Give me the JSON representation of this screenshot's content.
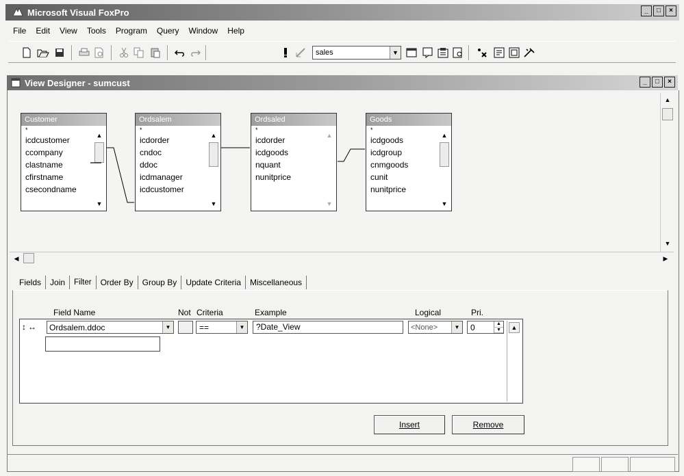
{
  "app": {
    "title": "Microsoft Visual FoxPro"
  },
  "menu": [
    "File",
    "Edit",
    "View",
    "Tools",
    "Program",
    "Query",
    "Window",
    "Help"
  ],
  "toolbar": {
    "database_combo_value": "sales"
  },
  "designer": {
    "title": "View Designer - sumcust",
    "tables": [
      {
        "name": "Customer",
        "fields": [
          "*",
          "icdcustomer",
          "ccompany",
          "clastname",
          "cfirstname",
          "csecondname"
        ]
      },
      {
        "name": "Ordsalem",
        "fields": [
          "*",
          "icdorder",
          "cndoc",
          "ddoc",
          "icdmanager",
          "icdcustomer"
        ]
      },
      {
        "name": "Ordsaled",
        "fields": [
          "*",
          "icdorder",
          "icdgoods",
          "nquant",
          "nunitprice"
        ]
      },
      {
        "name": "Goods",
        "fields": [
          "*",
          "icdgoods",
          "icdgroup",
          "cnmgoods",
          "cunit",
          "nunitprice"
        ]
      }
    ]
  },
  "tabs": [
    "Fields",
    "Join",
    "Filter",
    "Order By",
    "Group By",
    "Update Criteria",
    "Miscellaneous"
  ],
  "filter": {
    "headers": {
      "field_name": "Field Name",
      "not": "Not",
      "criteria": "Criteria",
      "example": "Example",
      "logical": "Logical",
      "pri": "Pri."
    },
    "row": {
      "field_name": "Ordsalem.ddoc",
      "criteria": "==",
      "example": "?Date_View",
      "logical": "<None>",
      "pri": "0"
    }
  },
  "buttons": {
    "insert": "Insert",
    "remove": "Remove"
  },
  "colors": {
    "title_dark": "#5e5e5e",
    "title_light": "#cfcfcf",
    "background": "#f3f3f1"
  }
}
